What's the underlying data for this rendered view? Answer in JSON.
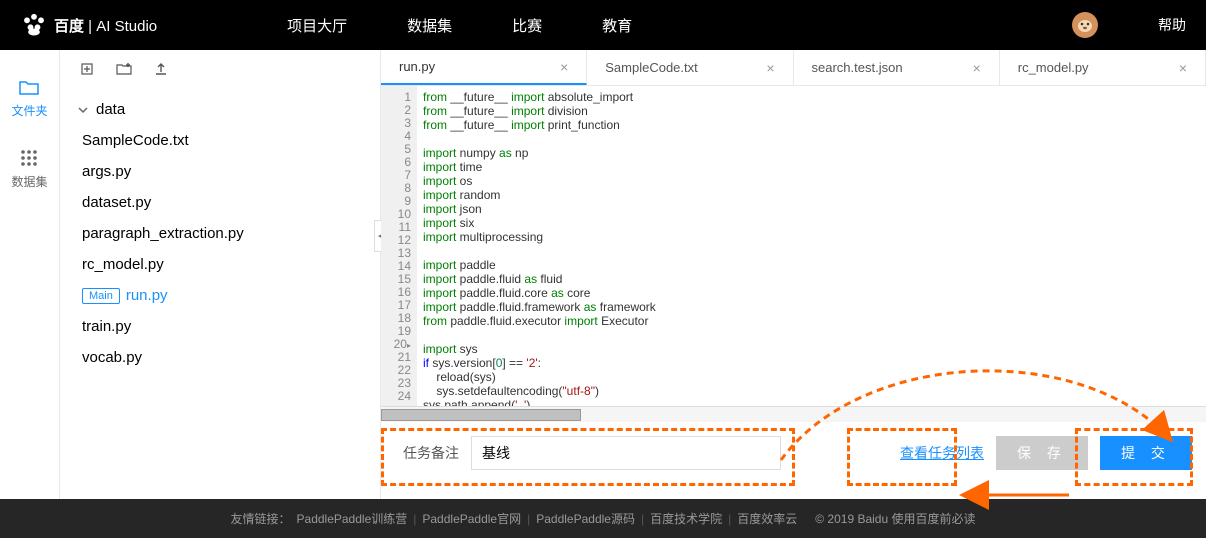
{
  "header": {
    "logo_cn": "百度",
    "logo_en": "AI Studio",
    "nav": [
      "项目大厅",
      "数据集",
      "比赛",
      "教育"
    ],
    "help": "帮助"
  },
  "leftbar": {
    "files": "文件夹",
    "datasets": "数据集"
  },
  "filetree": {
    "folder": "data",
    "files": [
      "SampleCode.txt",
      "args.py",
      "dataset.py",
      "paragraph_extraction.py",
      "rc_model.py",
      "run.py",
      "train.py",
      "vocab.py"
    ],
    "active_file": "run.py",
    "main_badge": "Main"
  },
  "tabs": [
    {
      "name": "run.py",
      "active": true
    },
    {
      "name": "SampleCode.txt",
      "active": false
    },
    {
      "name": "search.test.json",
      "active": false
    },
    {
      "name": "rc_model.py",
      "active": false
    }
  ],
  "code_lines": 24,
  "taskbar": {
    "label": "任务备注",
    "value": "基线",
    "view_link": "查看任务列表",
    "save": "保 存",
    "submit": "提 交"
  },
  "footer": {
    "label": "友情链接：",
    "links": [
      "PaddlePaddle训练营",
      "PaddlePaddle官网",
      "PaddlePaddle源码",
      "百度技术学院",
      "百度效率云"
    ],
    "copyright": "© 2019 Baidu 使用百度前必读"
  }
}
